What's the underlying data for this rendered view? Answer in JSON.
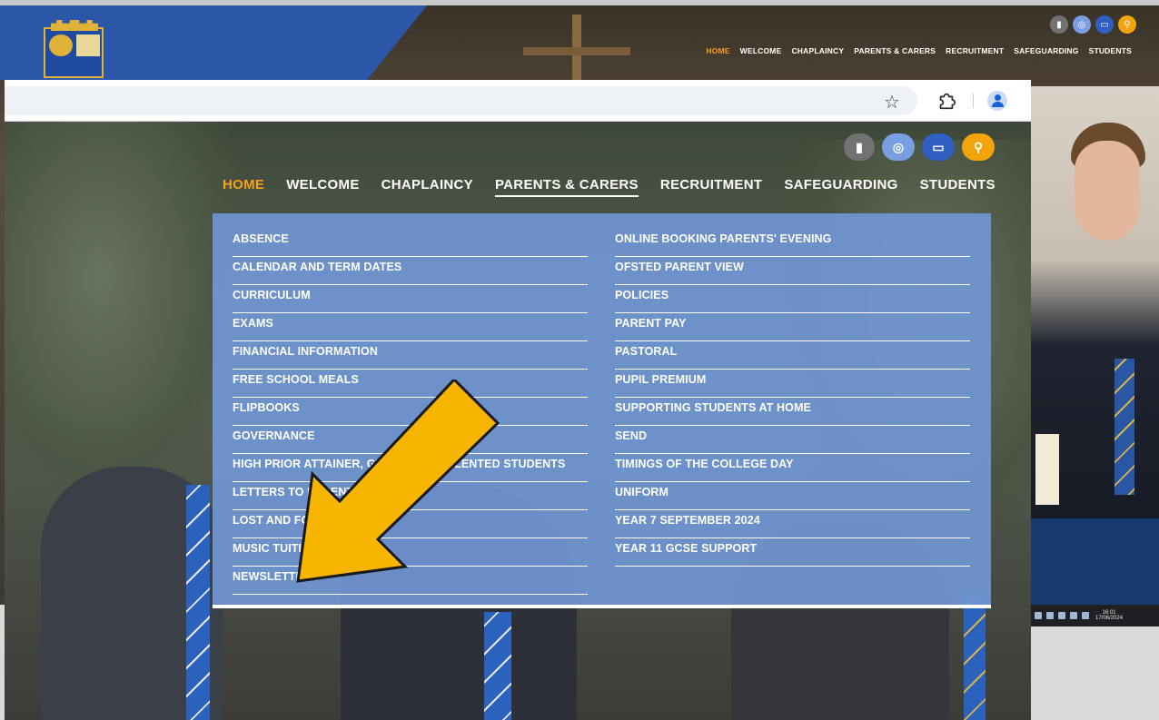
{
  "outer_site": {
    "nav": [
      "HOME",
      "WELCOME",
      "CHAPLAINCY",
      "PARENTS & CARERS",
      "RECRUITMENT",
      "SAFEGUARDING",
      "STUDENTS"
    ],
    "icons": [
      "office-icon",
      "instagram-icon",
      "id-card-icon",
      "search-icon"
    ],
    "taskbar": {
      "time": "16:01",
      "date": "17/06/2024"
    }
  },
  "browser": {
    "toolbar_icons": [
      "star-icon",
      "extensions-icon",
      "profile-icon"
    ]
  },
  "site": {
    "header_icons": [
      {
        "name": "office-icon",
        "glyph": "▮",
        "color": "#727272"
      },
      {
        "name": "instagram-icon",
        "glyph": "◎",
        "color": "#7a9ee2"
      },
      {
        "name": "id-card-icon",
        "glyph": "▭",
        "color": "#2f5fc0"
      },
      {
        "name": "search-icon",
        "glyph": "⚲",
        "color": "#f2a40c"
      }
    ],
    "nav": {
      "home": "HOME",
      "welcome": "WELCOME",
      "chaplaincy": "CHAPLAINCY",
      "parents": "PARENTS & CARERS",
      "recruitment": "RECRUITMENT",
      "safeguarding": "SAFEGUARDING",
      "students": "STUDENTS"
    },
    "active_color": "#f4a21c",
    "dropdown": {
      "left": [
        "ABSENCE",
        "CALENDAR AND TERM DATES",
        "CURRICULUM",
        "EXAMS",
        "FINANCIAL INFORMATION",
        "FREE SCHOOL MEALS",
        "FLIPBOOKS",
        "GOVERNANCE",
        "HIGH PRIOR ATTAINER, GIFTED AND TALENTED STUDENTS",
        "LETTERS TO PARENTS",
        "LOST AND FOUND",
        "MUSIC TUITION",
        "NEWSLETTERS"
      ],
      "right": [
        "ONLINE BOOKING PARENTS' EVENING",
        "OFSTED PARENT VIEW",
        "POLICIES",
        "PARENT PAY",
        "PASTORAL",
        "PUPIL PREMIUM",
        "SUPPORTING STUDENTS AT HOME",
        "SEND",
        "TIMINGS OF THE COLLEGE DAY",
        "UNIFORM",
        "YEAR 7 SEPTEMBER 2024",
        "YEAR 11 GCSE SUPPORT"
      ]
    }
  },
  "annotation": {
    "arrow_color": "#f7b500",
    "arrow_outline": "#1a1a1a"
  }
}
